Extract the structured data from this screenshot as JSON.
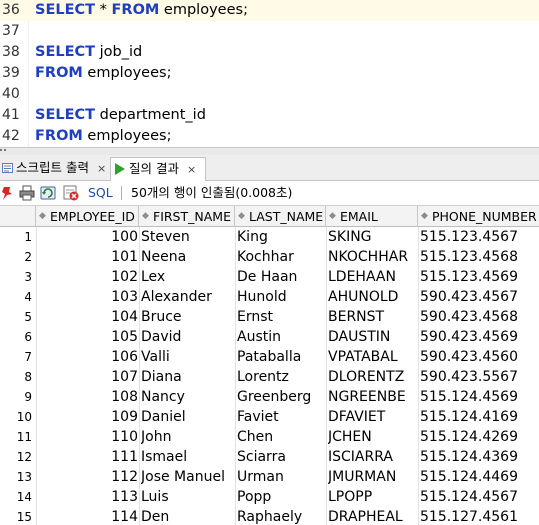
{
  "editor": {
    "lines": [
      {
        "num": "36",
        "parts": [
          {
            "kw": true,
            "t": "SELECT"
          },
          {
            "kw": false,
            "t": " * "
          },
          {
            "kw": true,
            "t": "FROM"
          },
          {
            "kw": false,
            "t": " employees;"
          }
        ]
      },
      {
        "num": "37",
        "parts": []
      },
      {
        "num": "38",
        "parts": [
          {
            "kw": true,
            "t": "SELECT"
          },
          {
            "kw": false,
            "t": " job_id"
          }
        ]
      },
      {
        "num": "39",
        "parts": [
          {
            "kw": true,
            "t": "FROM"
          },
          {
            "kw": false,
            "t": " employees;"
          }
        ]
      },
      {
        "num": "40",
        "parts": []
      },
      {
        "num": "41",
        "parts": [
          {
            "kw": true,
            "t": "SELECT"
          },
          {
            "kw": false,
            "t": " department_id"
          }
        ]
      },
      {
        "num": "42",
        "parts": [
          {
            "kw": true,
            "t": "FROM"
          },
          {
            "kw": false,
            "t": " employees;"
          }
        ]
      }
    ]
  },
  "tabs": [
    {
      "label": "스크립트 출력",
      "close": "×",
      "icon": "script-output-icon"
    },
    {
      "label": "질의 결과",
      "close": "×",
      "icon": "run-query-icon"
    }
  ],
  "toolbar": {
    "sql_label": "SQL",
    "status": "50개의 행이 인출됨(0.008초)",
    "icons": [
      "pin-icon",
      "print-icon",
      "refresh-icon",
      "cancel-query-icon"
    ]
  },
  "grid": {
    "columns": [
      "EMPLOYEE_ID",
      "FIRST_NAME",
      "LAST_NAME",
      "EMAIL",
      "PHONE_NUMBER"
    ],
    "rows": [
      [
        "1",
        "100",
        "Steven",
        "King",
        "SKING",
        "515.123.4567"
      ],
      [
        "2",
        "101",
        "Neena",
        "Kochhar",
        "NKOCHHAR",
        "515.123.4568"
      ],
      [
        "3",
        "102",
        "Lex",
        "De Haan",
        "LDEHAAN",
        "515.123.4569"
      ],
      [
        "4",
        "103",
        "Alexander",
        "Hunold",
        "AHUNOLD",
        "590.423.4567"
      ],
      [
        "5",
        "104",
        "Bruce",
        "Ernst",
        "BERNST",
        "590.423.4568"
      ],
      [
        "6",
        "105",
        "David",
        "Austin",
        "DAUSTIN",
        "590.423.4569"
      ],
      [
        "7",
        "106",
        "Valli",
        "Pataballa",
        "VPATABAL",
        "590.423.4560"
      ],
      [
        "8",
        "107",
        "Diana",
        "Lorentz",
        "DLORENTZ",
        "590.423.5567"
      ],
      [
        "9",
        "108",
        "Nancy",
        "Greenberg",
        "NGREENBE",
        "515.124.4569"
      ],
      [
        "10",
        "109",
        "Daniel",
        "Faviet",
        "DFAVIET",
        "515.124.4169"
      ],
      [
        "11",
        "110",
        "John",
        "Chen",
        "JCHEN",
        "515.124.4269"
      ],
      [
        "12",
        "111",
        "Ismael",
        "Sciarra",
        "ISCIARRA",
        "515.124.4369"
      ],
      [
        "13",
        "112",
        "Jose Manuel",
        "Urman",
        "JMURMAN",
        "515.124.4469"
      ],
      [
        "14",
        "113",
        "Luis",
        "Popp",
        "LPOPP",
        "515.124.4567"
      ],
      [
        "15",
        "114",
        "Den",
        "Raphaely",
        "DRAPHEAL",
        "515.127.4561"
      ]
    ]
  }
}
